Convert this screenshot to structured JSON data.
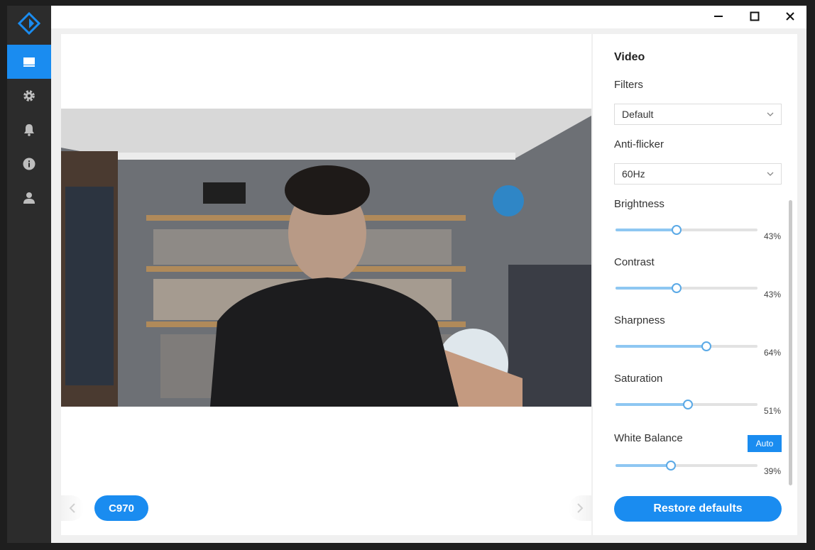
{
  "window": {
    "minimize_icon": "minimize-icon",
    "maximize_icon": "maximize-icon",
    "close_icon": "close-icon"
  },
  "sidebar": {
    "logo": "app-logo",
    "items": [
      {
        "icon": "display-icon",
        "active": true
      },
      {
        "icon": "gear-icon",
        "active": false
      },
      {
        "icon": "bell-icon",
        "active": false
      },
      {
        "icon": "info-icon",
        "active": false
      },
      {
        "icon": "user-icon",
        "active": false
      }
    ]
  },
  "preview": {
    "device_label": "C970",
    "prev_icon": "chevron-left-icon",
    "next_icon": "chevron-right-icon"
  },
  "video": {
    "title": "Video",
    "filters_label": "Filters",
    "filters_value": "Default",
    "antiflicker_label": "Anti-flicker",
    "antiflicker_value": "60Hz",
    "brightness_label": "Brightness",
    "brightness_value": "43%",
    "brightness_level": 0.43,
    "contrast_label": "Contrast",
    "contrast_value": "43%",
    "contrast_level": 0.43,
    "sharpness_label": "Sharpness",
    "sharpness_value": "64%",
    "sharpness_level": 0.64,
    "saturation_label": "Saturation",
    "saturation_value": "51%",
    "saturation_level": 0.51,
    "white_balance_label": "White Balance",
    "white_balance_auto": "Auto",
    "white_balance_value": "39%",
    "white_balance_level": 0.39,
    "restore_label": "Restore defaults"
  },
  "colors": {
    "accent": "#1a8cf0",
    "sidebar": "#2c2c2c",
    "slider_fill": "#8ec7f2"
  }
}
